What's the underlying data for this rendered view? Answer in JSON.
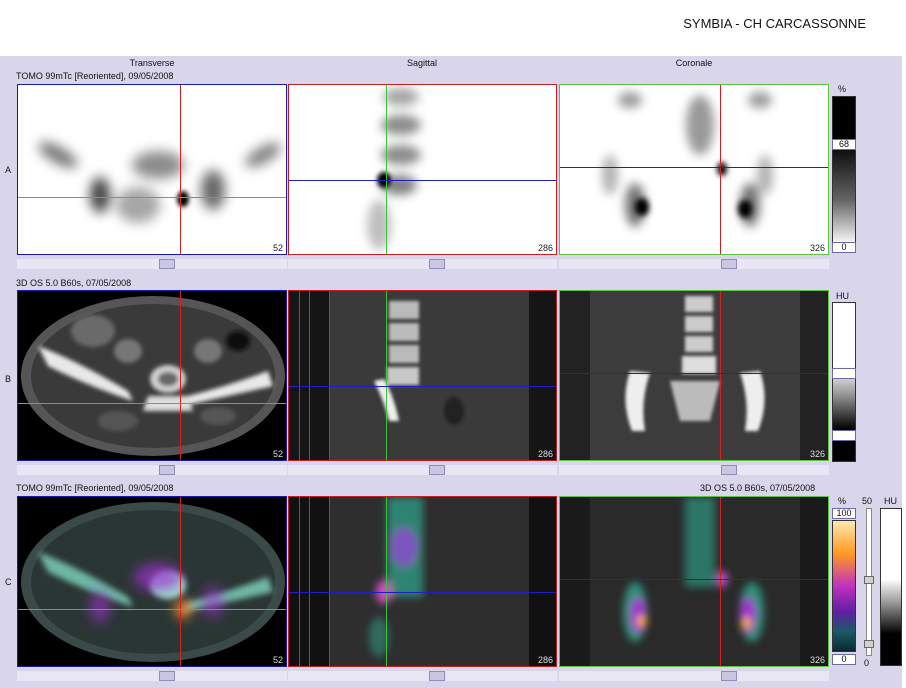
{
  "header": {
    "title": "SYMBIA - CH CARCASSONNE"
  },
  "columns": {
    "transverse": "Transverse",
    "sagittal": "Sagittal",
    "coronal": "Coronale"
  },
  "rows": {
    "a": {
      "letter": "A",
      "series": "TOMO 99mTc [Reoriented], 09/05/2008"
    },
    "b": {
      "letter": "B",
      "series": "3D  OS  5.0  B60s, 07/05/2008"
    },
    "c": {
      "letter": "C",
      "series_left": "TOMO 99mTc [Reoriented], 09/05/2008",
      "series_right": "3D  OS  5.0  B60s, 07/05/2008"
    }
  },
  "slices": {
    "transverse": "52",
    "sagittal": "286",
    "coronal": "326"
  },
  "colorbars": {
    "a": {
      "unit": "%",
      "max": "68",
      "min": "0"
    },
    "b": {
      "unit": "HU"
    },
    "c": {
      "unit": "%",
      "max": "100",
      "min": "0",
      "slider_value": "50",
      "slider_min": "0",
      "ct_unit": "HU"
    }
  },
  "colors": {
    "crosshair_red": "#d42020",
    "crosshair_green": "#40c040",
    "crosshair_blue": "#2020c0",
    "frame_blue": "#1a1aa8",
    "frame_red": "#c02020",
    "frame_green": "#60c040",
    "workspace_bg": "#d9d6ec"
  }
}
